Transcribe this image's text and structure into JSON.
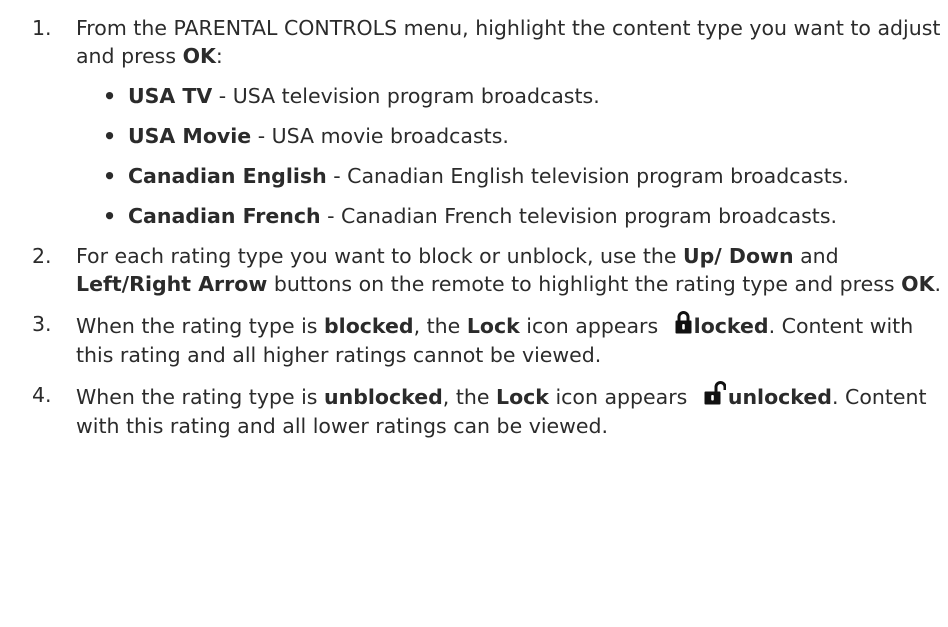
{
  "steps": [
    {
      "num": "1.",
      "pre": "From the PARENTAL CONTROLS menu, highlight the content type you want to adjust and press ",
      "key": "OK",
      "post": ":",
      "items": [
        {
          "term": "USA TV",
          "desc": " - USA television program broadcasts."
        },
        {
          "term": "USA Movie",
          "desc": " - USA movie broadcasts."
        },
        {
          "term": "Canadian English",
          "desc": " - Canadian English television program broadcasts."
        },
        {
          "term": "Canadian French",
          "desc": " - Canadian French television program broadcasts."
        }
      ]
    },
    {
      "num": "2.",
      "t1": "For each rating type you want to block or unblock, use the ",
      "b1": "Up/ Down",
      "t2": " and ",
      "b2": "Left/Right Arrow",
      "t3": " buttons on the remote to highlight the rating type and press ",
      "b3": "OK",
      "t4": "."
    },
    {
      "num": "3.",
      "t1": "When the rating type is ",
      "b1": "blocked",
      "t2": ", the ",
      "b2": "Lock",
      "t3": " icon appears ",
      "icon": "lock-closed-icon",
      "b3": "locked",
      "t4": ". Content with this rating and all higher ratings cannot be viewed."
    },
    {
      "num": "4.",
      "t1": "When the rating type is ",
      "b1": "unblocked",
      "t2": ", the ",
      "b2": "Lock",
      "t3": " icon appears ",
      "icon": "lock-open-icon",
      "b3": "unlocked",
      "t4": ". Content with this rating and all lower ratings can be viewed."
    }
  ]
}
